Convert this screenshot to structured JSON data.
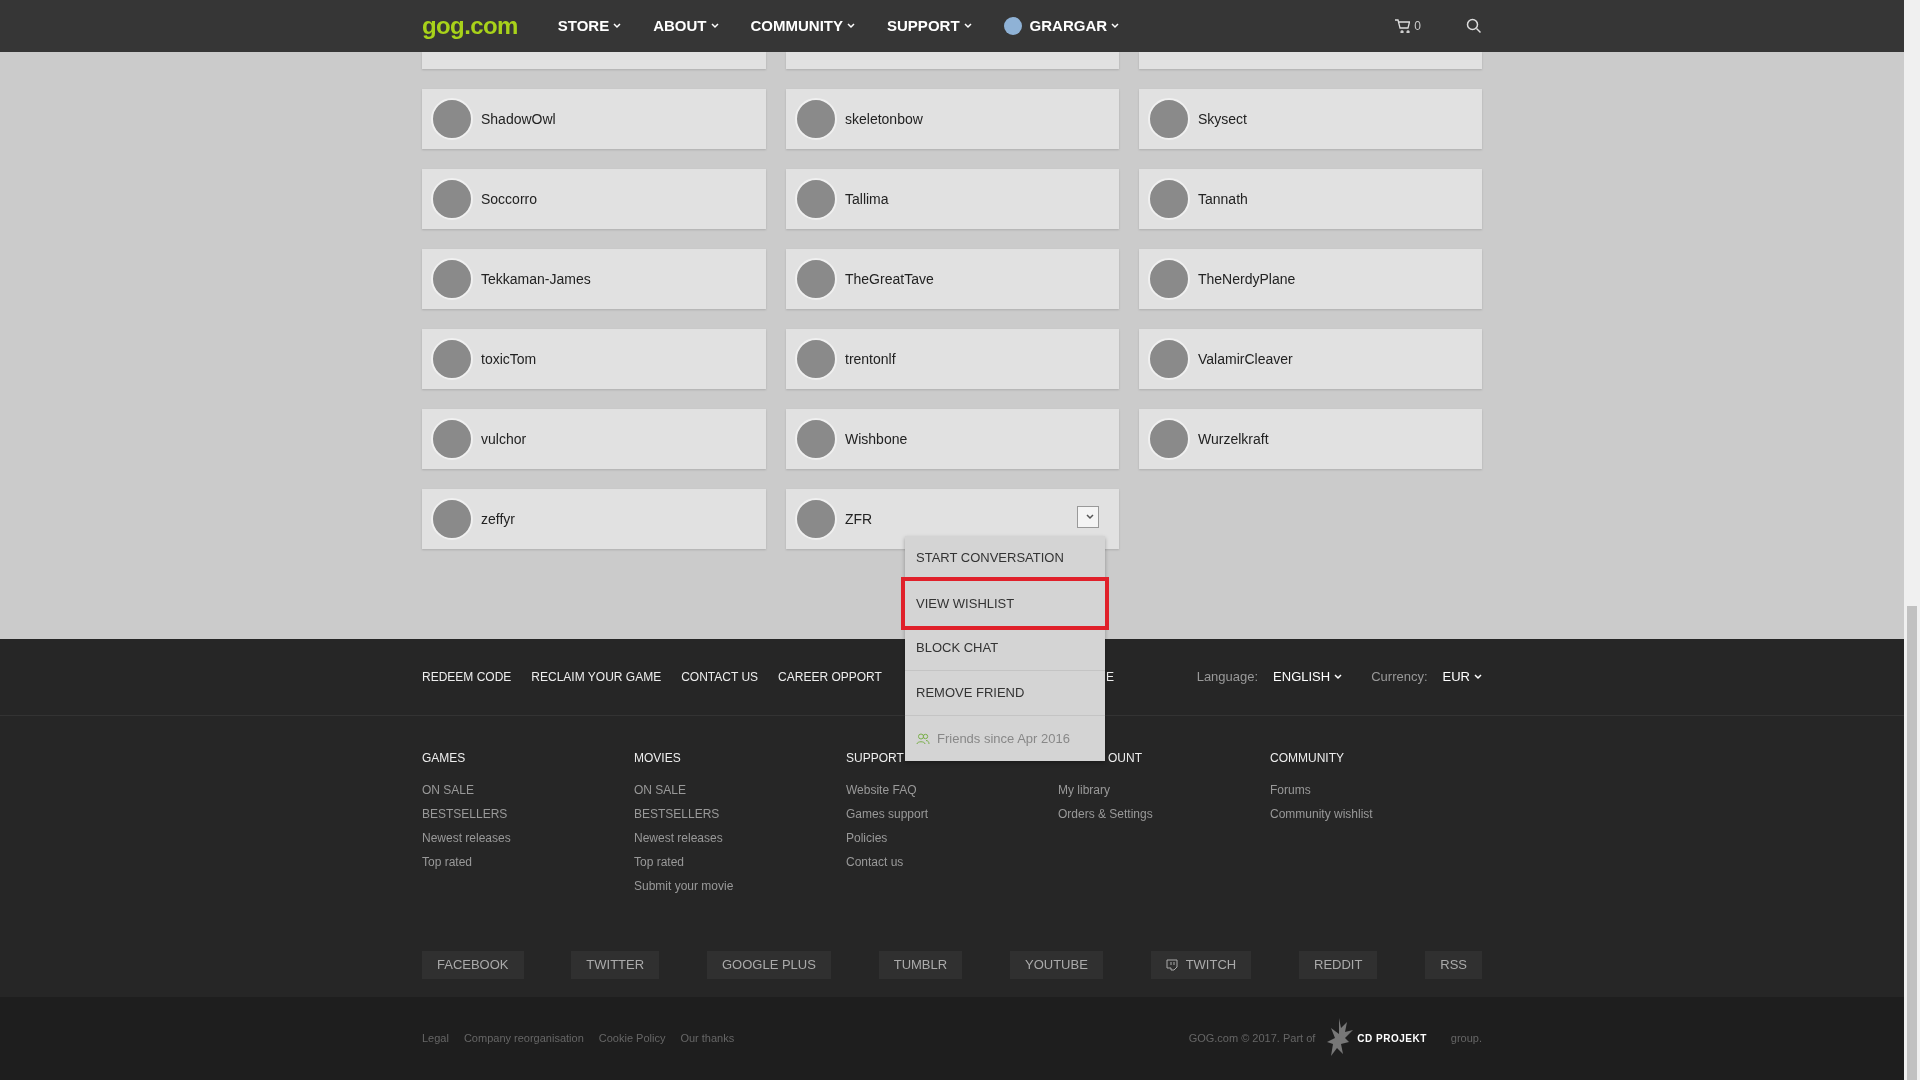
{
  "nav": {
    "logo": "gog.com",
    "items": [
      {
        "label": "STORE"
      },
      {
        "label": "ABOUT"
      },
      {
        "label": "COMMUNITY"
      },
      {
        "label": "SUPPORT"
      }
    ],
    "user": "GRARGAR",
    "cart_count": "0"
  },
  "friends": [
    {
      "name": "ShadowOwl",
      "menu_open": false
    },
    {
      "name": "skeletonbow",
      "menu_open": false
    },
    {
      "name": "Skysect",
      "menu_open": false
    },
    {
      "name": "Soccorro",
      "menu_open": false
    },
    {
      "name": "Tallima",
      "menu_open": false
    },
    {
      "name": "Tannath",
      "menu_open": false
    },
    {
      "name": "Tekkaman-James",
      "menu_open": false
    },
    {
      "name": "TheGreatTave",
      "menu_open": false
    },
    {
      "name": "TheNerdyPlane",
      "menu_open": false
    },
    {
      "name": "toxicTom",
      "menu_open": false
    },
    {
      "name": "trentonlf",
      "menu_open": false
    },
    {
      "name": "ValamirCleaver",
      "menu_open": false
    },
    {
      "name": "vulchor",
      "menu_open": false
    },
    {
      "name": "Wishbone",
      "menu_open": false
    },
    {
      "name": "Wurzelkraft",
      "menu_open": false
    },
    {
      "name": "zeffyr",
      "menu_open": false
    },
    {
      "name": "ZFR",
      "menu_open": true
    }
  ],
  "friend_menu": {
    "items": [
      {
        "label": "START CONVERSATION",
        "highlighted": false
      },
      {
        "label": "VIEW WISHLIST",
        "highlighted": true
      },
      {
        "label": "BLOCK CHAT",
        "highlighted": false
      },
      {
        "label": "REMOVE FRIEND",
        "highlighted": false
      }
    ],
    "note": "Friends since Apr 2016"
  },
  "footer": {
    "links": [
      "REDEEM CODE",
      "RECLAIM YOUR GAME",
      "CONTACT US",
      "CAREER OPPORT",
      "E"
    ],
    "language_label": "Language:",
    "language": "ENGLISH",
    "currency_label": "Currency:",
    "currency": "EUR",
    "columns": [
      {
        "heading": "GAMES",
        "cut": false,
        "links": [
          "ON SALE",
          "BESTSELLERS",
          "Newest releases",
          "Top rated"
        ]
      },
      {
        "heading": "MOVIES",
        "cut": false,
        "links": [
          "ON SALE",
          "BESTSELLERS",
          "Newest releases",
          "Top rated",
          "Submit your movie"
        ]
      },
      {
        "heading": "SUPPORT",
        "cut": false,
        "links": [
          "Website FAQ",
          "Games support",
          "Policies",
          "Contact us"
        ]
      },
      {
        "heading": "OUNT",
        "cut": true,
        "links": [
          "My library",
          "Orders & Settings"
        ]
      },
      {
        "heading": "COMMUNITY",
        "cut": false,
        "links": [
          "Forums",
          "Community wishlist"
        ]
      }
    ],
    "social": [
      {
        "label": "FACEBOOK",
        "kind": "plain"
      },
      {
        "label": "TWITTER",
        "kind": "plain"
      },
      {
        "label": "GOOGLE PLUS",
        "kind": "plain"
      },
      {
        "label": "TUMBLR",
        "kind": "plain"
      },
      {
        "label": "YOUTUBE",
        "kind": "plain"
      },
      {
        "label": "TWITCH",
        "kind": "icon"
      },
      {
        "label": "REDDIT",
        "kind": "plain"
      },
      {
        "label": "RSS",
        "kind": "plain"
      }
    ],
    "legal": [
      "Legal",
      "Company reorganisation",
      "Cookie Policy",
      "Our thanks"
    ],
    "copyright": "GOG.com © 2017. Part of",
    "brand": "CD PROJEKT",
    "group": "group."
  }
}
